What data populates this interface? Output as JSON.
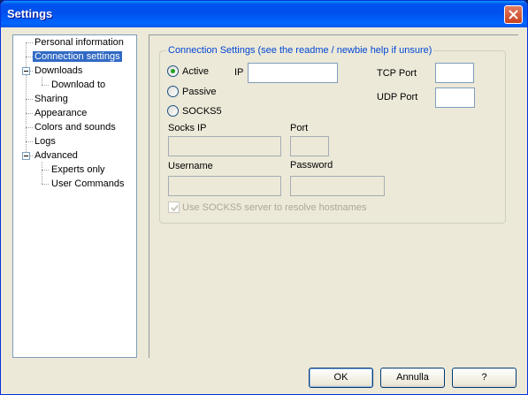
{
  "window": {
    "title": "Settings"
  },
  "tree": {
    "items": [
      {
        "label": "Personal information"
      },
      {
        "label": "Connection settings"
      },
      {
        "label": "Downloads"
      },
      {
        "label": "Download to"
      },
      {
        "label": "Sharing"
      },
      {
        "label": "Appearance"
      },
      {
        "label": "Colors and sounds"
      },
      {
        "label": "Logs"
      },
      {
        "label": "Advanced"
      },
      {
        "label": "Experts only"
      },
      {
        "label": "User Commands"
      }
    ],
    "selected": "Connection settings"
  },
  "connection": {
    "group_title": "Connection Settings (see the readme / newbie help if unsure)",
    "mode_active": "Active",
    "mode_passive": "Passive",
    "mode_socks5": "SOCKS5",
    "selected_mode": "Active",
    "ip_label": "IP",
    "ip_value": "",
    "tcp_port_label": "TCP Port",
    "tcp_port_value": "",
    "udp_port_label": "UDP Port",
    "udp_port_value": "",
    "socks_ip_label": "Socks IP",
    "socks_ip_value": "",
    "port_label": "Port",
    "port_value": "",
    "username_label": "Username",
    "username_value": "",
    "password_label": "Password",
    "password_value": "",
    "resolve_label": "Use SOCKS5 server to resolve hostnames",
    "resolve_checked": true
  },
  "buttons": {
    "ok": "OK",
    "cancel": "Annulla",
    "help": "?"
  }
}
